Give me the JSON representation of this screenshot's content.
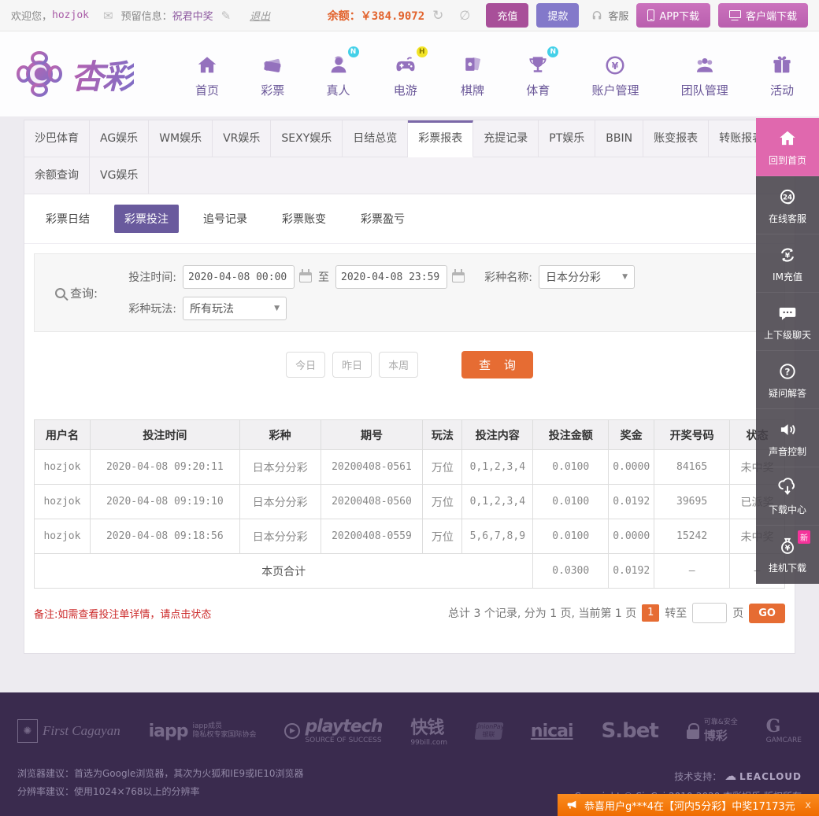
{
  "topbar": {
    "welcome": "欢迎您，",
    "username": "hozjok",
    "reserved_label": "预留信息：",
    "reserved_value": "祝君中奖",
    "logout": "退出",
    "balance_label": "余额：",
    "balance_value": "￥384.9072",
    "deposit": "充值",
    "withdraw": "提款",
    "service": "客服",
    "app_download": "APP下载",
    "client_download": "客户端下载"
  },
  "header": {
    "brand": "杏彩",
    "nav": [
      {
        "label": "首页",
        "badge": ""
      },
      {
        "label": "彩票",
        "badge": ""
      },
      {
        "label": "真人",
        "badge": "N"
      },
      {
        "label": "电游",
        "badge": "H"
      },
      {
        "label": "棋牌",
        "badge": ""
      },
      {
        "label": "体育",
        "badge": "N"
      },
      {
        "label": "账户管理",
        "badge": ""
      },
      {
        "label": "团队管理",
        "badge": ""
      },
      {
        "label": "活动",
        "badge": ""
      }
    ]
  },
  "tabs": {
    "row1": [
      "沙巴体育",
      "AG娱乐",
      "WM娱乐",
      "VR娱乐",
      "SEXY娱乐",
      "日结总览",
      "彩票报表",
      "充提记录",
      "PT娱乐",
      "BBIN",
      "账变报表",
      "转账报表"
    ],
    "row2": [
      "余额查询",
      "VG娱乐"
    ],
    "active": "彩票报表"
  },
  "subtabs": [
    "彩票日结",
    "彩票投注",
    "追号记录",
    "彩票账变",
    "彩票盈亏"
  ],
  "filter": {
    "query_label": "查询:",
    "bet_time_label": "投注时间:",
    "from_value": "2020-04-08 00:00:00",
    "to_label": "至",
    "to_value": "2020-04-08 23:59:59",
    "lottery_name_label": "彩种名称:",
    "lottery_name_value": "日本分分彩",
    "play_type_label": "彩种玩法:",
    "play_type_value": "所有玩法"
  },
  "actions": {
    "today": "今日",
    "yesterday": "昨日",
    "week": "本周",
    "query": "查 询"
  },
  "table": {
    "headers": [
      "用户名",
      "投注时间",
      "彩种",
      "期号",
      "玩法",
      "投注内容",
      "投注金额",
      "奖金",
      "开奖号码",
      "状态"
    ],
    "rows": [
      {
        "cells": [
          "hozjok",
          "2020-04-08 09:20:11",
          "日本分分彩",
          "20200408-0561",
          "万位",
          "0,1,2,3,4",
          "0.0100",
          "0.0000",
          "84165",
          "未中奖"
        ],
        "status_style": "st-lose"
      },
      {
        "cells": [
          "hozjok",
          "2020-04-08 09:19:10",
          "日本分分彩",
          "20200408-0560",
          "万位",
          "0,1,2,3,4",
          "0.0100",
          "0.0192",
          "39695",
          "已派奖"
        ],
        "status_style": "st-win"
      },
      {
        "cells": [
          "hozjok",
          "2020-04-08 09:18:56",
          "日本分分彩",
          "20200408-0559",
          "万位",
          "5,6,7,8,9",
          "0.0100",
          "0.0000",
          "15242",
          "未中奖"
        ],
        "status_style": "st-lose"
      }
    ],
    "summary": {
      "label": "本页合计",
      "bet_total": "0.0300",
      "prize_total": "0.0192",
      "dash1": "—",
      "dash2": "—"
    }
  },
  "note": "备注:如需查看投注单详情，请点击状态",
  "pagination": {
    "summary_text": "总计 3 个记录, 分为 1 页, 当前第 1 页",
    "current": "1",
    "goto_label": "转至",
    "goto_value": "",
    "page_label": "页",
    "go": "GO"
  },
  "sidebar": [
    {
      "label": "回到首页",
      "badge": ""
    },
    {
      "label": "在线客服",
      "badge": ""
    },
    {
      "label": "IM充值",
      "badge": ""
    },
    {
      "label": "上下级聊天",
      "badge": ""
    },
    {
      "label": "疑问解答",
      "badge": ""
    },
    {
      "label": "声音控制",
      "badge": ""
    },
    {
      "label": "下载中心",
      "badge": ""
    },
    {
      "label": "挂机下载",
      "badge": "新"
    }
  ],
  "footer": {
    "logos": [
      {
        "name": "First Cagayan",
        "sub": ""
      },
      {
        "name": "iapp",
        "sub": "iapp成员\n隐私权专家国际协会"
      },
      {
        "name": "playtech",
        "sub": "SOURCE OF SUCCESS"
      },
      {
        "name": "快钱",
        "sub": "99bill.com"
      },
      {
        "name": "UnionPay",
        "sub": "银联"
      },
      {
        "name": "nicai",
        "sub": ""
      },
      {
        "name": "S.bet",
        "sub": ""
      },
      {
        "name": "博彩",
        "sub": "可靠&安全"
      },
      {
        "name": "G",
        "sub": "GAMCARE"
      }
    ],
    "tips": [
      "浏览器建议：首选为Google浏览器，其次为火狐和IE9或IE10浏览器",
      "分辨率建议：使用1024×768以上的分辨率"
    ],
    "support_label": "技术支持：",
    "support_brand": "LEACLOUD",
    "copyright": "Copyright © SinCai 2010-2020 杏彩娱乐 版权所有"
  },
  "notification": {
    "text": "恭喜用户g***4在【河内5分彩】中奖17173元",
    "close": "x"
  }
}
